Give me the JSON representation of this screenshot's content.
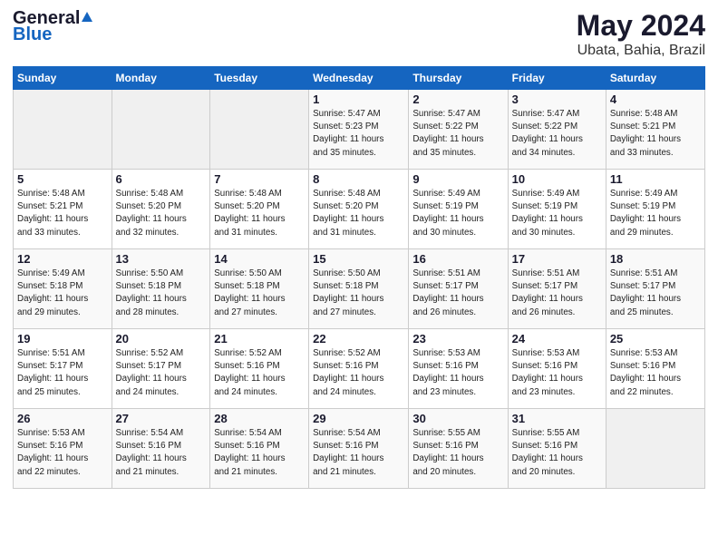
{
  "header": {
    "logo_general": "General",
    "logo_blue": "Blue",
    "title": "May 2024",
    "subtitle": "Ubata, Bahia, Brazil"
  },
  "weekdays": [
    "Sunday",
    "Monday",
    "Tuesday",
    "Wednesday",
    "Thursday",
    "Friday",
    "Saturday"
  ],
  "weeks": [
    [
      {
        "day": "",
        "info": ""
      },
      {
        "day": "",
        "info": ""
      },
      {
        "day": "",
        "info": ""
      },
      {
        "day": "1",
        "info": "Sunrise: 5:47 AM\nSunset: 5:23 PM\nDaylight: 11 hours\nand 35 minutes."
      },
      {
        "day": "2",
        "info": "Sunrise: 5:47 AM\nSunset: 5:22 PM\nDaylight: 11 hours\nand 35 minutes."
      },
      {
        "day": "3",
        "info": "Sunrise: 5:47 AM\nSunset: 5:22 PM\nDaylight: 11 hours\nand 34 minutes."
      },
      {
        "day": "4",
        "info": "Sunrise: 5:48 AM\nSunset: 5:21 PM\nDaylight: 11 hours\nand 33 minutes."
      }
    ],
    [
      {
        "day": "5",
        "info": "Sunrise: 5:48 AM\nSunset: 5:21 PM\nDaylight: 11 hours\nand 33 minutes."
      },
      {
        "day": "6",
        "info": "Sunrise: 5:48 AM\nSunset: 5:20 PM\nDaylight: 11 hours\nand 32 minutes."
      },
      {
        "day": "7",
        "info": "Sunrise: 5:48 AM\nSunset: 5:20 PM\nDaylight: 11 hours\nand 31 minutes."
      },
      {
        "day": "8",
        "info": "Sunrise: 5:48 AM\nSunset: 5:20 PM\nDaylight: 11 hours\nand 31 minutes."
      },
      {
        "day": "9",
        "info": "Sunrise: 5:49 AM\nSunset: 5:19 PM\nDaylight: 11 hours\nand 30 minutes."
      },
      {
        "day": "10",
        "info": "Sunrise: 5:49 AM\nSunset: 5:19 PM\nDaylight: 11 hours\nand 30 minutes."
      },
      {
        "day": "11",
        "info": "Sunrise: 5:49 AM\nSunset: 5:19 PM\nDaylight: 11 hours\nand 29 minutes."
      }
    ],
    [
      {
        "day": "12",
        "info": "Sunrise: 5:49 AM\nSunset: 5:18 PM\nDaylight: 11 hours\nand 29 minutes."
      },
      {
        "day": "13",
        "info": "Sunrise: 5:50 AM\nSunset: 5:18 PM\nDaylight: 11 hours\nand 28 minutes."
      },
      {
        "day": "14",
        "info": "Sunrise: 5:50 AM\nSunset: 5:18 PM\nDaylight: 11 hours\nand 27 minutes."
      },
      {
        "day": "15",
        "info": "Sunrise: 5:50 AM\nSunset: 5:18 PM\nDaylight: 11 hours\nand 27 minutes."
      },
      {
        "day": "16",
        "info": "Sunrise: 5:51 AM\nSunset: 5:17 PM\nDaylight: 11 hours\nand 26 minutes."
      },
      {
        "day": "17",
        "info": "Sunrise: 5:51 AM\nSunset: 5:17 PM\nDaylight: 11 hours\nand 26 minutes."
      },
      {
        "day": "18",
        "info": "Sunrise: 5:51 AM\nSunset: 5:17 PM\nDaylight: 11 hours\nand 25 minutes."
      }
    ],
    [
      {
        "day": "19",
        "info": "Sunrise: 5:51 AM\nSunset: 5:17 PM\nDaylight: 11 hours\nand 25 minutes."
      },
      {
        "day": "20",
        "info": "Sunrise: 5:52 AM\nSunset: 5:17 PM\nDaylight: 11 hours\nand 24 minutes."
      },
      {
        "day": "21",
        "info": "Sunrise: 5:52 AM\nSunset: 5:16 PM\nDaylight: 11 hours\nand 24 minutes."
      },
      {
        "day": "22",
        "info": "Sunrise: 5:52 AM\nSunset: 5:16 PM\nDaylight: 11 hours\nand 24 minutes."
      },
      {
        "day": "23",
        "info": "Sunrise: 5:53 AM\nSunset: 5:16 PM\nDaylight: 11 hours\nand 23 minutes."
      },
      {
        "day": "24",
        "info": "Sunrise: 5:53 AM\nSunset: 5:16 PM\nDaylight: 11 hours\nand 23 minutes."
      },
      {
        "day": "25",
        "info": "Sunrise: 5:53 AM\nSunset: 5:16 PM\nDaylight: 11 hours\nand 22 minutes."
      }
    ],
    [
      {
        "day": "26",
        "info": "Sunrise: 5:53 AM\nSunset: 5:16 PM\nDaylight: 11 hours\nand 22 minutes."
      },
      {
        "day": "27",
        "info": "Sunrise: 5:54 AM\nSunset: 5:16 PM\nDaylight: 11 hours\nand 21 minutes."
      },
      {
        "day": "28",
        "info": "Sunrise: 5:54 AM\nSunset: 5:16 PM\nDaylight: 11 hours\nand 21 minutes."
      },
      {
        "day": "29",
        "info": "Sunrise: 5:54 AM\nSunset: 5:16 PM\nDaylight: 11 hours\nand 21 minutes."
      },
      {
        "day": "30",
        "info": "Sunrise: 5:55 AM\nSunset: 5:16 PM\nDaylight: 11 hours\nand 20 minutes."
      },
      {
        "day": "31",
        "info": "Sunrise: 5:55 AM\nSunset: 5:16 PM\nDaylight: 11 hours\nand 20 minutes."
      },
      {
        "day": "",
        "info": ""
      }
    ]
  ]
}
